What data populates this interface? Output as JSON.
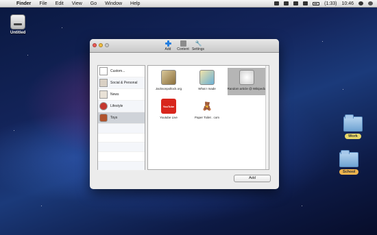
{
  "menubar": {
    "apple": "",
    "items": [
      "Finder",
      "File",
      "Edit",
      "View",
      "Go",
      "Window",
      "Help"
    ],
    "battery": "(1:33)",
    "clock": "10:46"
  },
  "desktop": {
    "untitled_label": "Untitled",
    "work_label": "Work",
    "school_label": "School"
  },
  "window": {
    "tabs": [
      {
        "label": "Add",
        "icon": "plus-icon"
      },
      {
        "label": "Content",
        "icon": "content-icon"
      },
      {
        "label": "Settings",
        "icon": "wrench-icon"
      }
    ],
    "sidebar": [
      {
        "label": "Custom..."
      },
      {
        "label": "Social & Personal"
      },
      {
        "label": "News"
      },
      {
        "label": "Lifestyle"
      },
      {
        "label": "Toys"
      }
    ],
    "grid": [
      {
        "label": "Jacksonpollock.org"
      },
      {
        "label": "What I made"
      },
      {
        "label": "Random article @ Wikipedia"
      },
      {
        "label": "Youtube Live",
        "thumb_text": "YouTube"
      },
      {
        "label": "Paper Toilet . com"
      }
    ],
    "add_button": "Add"
  }
}
